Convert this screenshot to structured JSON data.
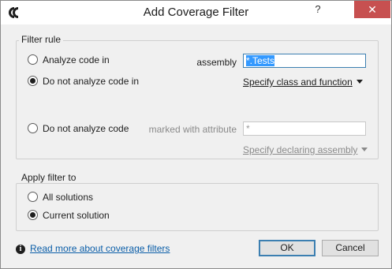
{
  "window": {
    "title": "Add Coverage Filter",
    "help_label": "?",
    "close_label": "✕"
  },
  "filter_rule": {
    "legend": "Filter rule",
    "options": [
      {
        "label": "Analyze code in",
        "checked": false
      },
      {
        "label": "Do not analyze code in",
        "checked": true
      },
      {
        "label": "Do not analyze code",
        "checked": false
      }
    ],
    "assembly_label": "assembly",
    "assembly_value": "*.Tests",
    "specify_class_label": "Specify class and function",
    "attribute_label": "marked with attribute",
    "attribute_placeholder": "*",
    "specify_assembly_label": "Specify declaring assembly"
  },
  "apply_filter": {
    "legend": "Apply filter to",
    "options": [
      {
        "label": "All solutions",
        "checked": false
      },
      {
        "label": "Current solution",
        "checked": true
      }
    ]
  },
  "footer": {
    "info_icon_glyph": "i",
    "read_more_label": "Read more about coverage filters",
    "ok_label": "OK",
    "cancel_label": "Cancel"
  }
}
